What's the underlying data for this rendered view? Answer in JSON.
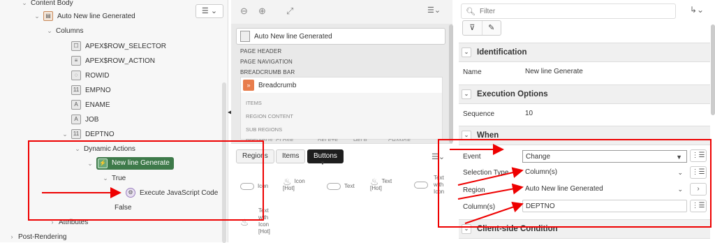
{
  "tree": {
    "items": [
      {
        "label": "Content Body",
        "chevron": "⌄"
      },
      {
        "label": "Auto New line Generated",
        "chevron": "⌄"
      },
      {
        "label": "Columns",
        "chevron": "⌄"
      },
      {
        "label": "APEX$ROW_SELECTOR"
      },
      {
        "label": "APEX$ROW_ACTION"
      },
      {
        "label": "ROWID"
      },
      {
        "label": "EMPNO"
      },
      {
        "label": "ENAME"
      },
      {
        "label": "JOB"
      },
      {
        "label": "DEPTNO",
        "chevron": "⌄"
      },
      {
        "label": "Dynamic Actions",
        "chevron": "⌄"
      },
      {
        "label": "New line Generate",
        "chevron": "⌄"
      },
      {
        "label": "True",
        "chevron": "⌄"
      },
      {
        "label": "Execute JavaScript Code"
      },
      {
        "label": "False"
      },
      {
        "label": "Attributes",
        "chevron": "›"
      },
      {
        "label": "Post-Rendering",
        "chevron": "›"
      }
    ]
  },
  "layout_panel": {
    "page_item": "Auto New line Generated",
    "labels": [
      "PAGE HEADER",
      "PAGE NAVIGATION",
      "BREADCRUMB BAR"
    ],
    "breadcrumb": "Breadcrumb",
    "sub_labels": [
      "ITEMS",
      "REGION CONTENT",
      "SUB REGIONS"
    ],
    "button_positions": [
      "PREVIOUS",
      "CLOSE",
      "DELETE",
      "HELP",
      "CHANGE"
    ]
  },
  "gallery": {
    "tabs": [
      "Regions",
      "Items",
      "Buttons"
    ],
    "active_tab": "Buttons",
    "items": [
      {
        "label": "Icon"
      },
      {
        "label": "Icon [Hot]"
      },
      {
        "label": "Text"
      },
      {
        "label": "Text [Hot]"
      },
      {
        "label": "Text with Icon"
      },
      {
        "label": "Text with Icon [Hot]"
      }
    ]
  },
  "property_editor": {
    "filter_placeholder": "Filter",
    "sections": [
      {
        "title": "Identification"
      },
      {
        "title": "Execution Options"
      },
      {
        "title": "When"
      },
      {
        "title": "Client-side Condition"
      }
    ],
    "name_label": "Name",
    "name_value": "New line Generate",
    "sequence_label": "Sequence",
    "sequence_value": "10",
    "event_label": "Event",
    "event_value": "Change",
    "selection_type_label": "Selection Type",
    "selection_type_value": "Column(s)",
    "region_label": "Region",
    "region_value": "Auto New line Generated",
    "columns_label": "Column(s)",
    "columns_value": "DEPTNO"
  },
  "colors": {
    "annotation": "#e00000",
    "selected": "#3e7a4a"
  },
  "icons": [
    "zoom-out-icon",
    "zoom-in-icon",
    "expand-icon",
    "menu-icon",
    "filter-icon",
    "edit-icon",
    "goto-icon",
    "list-icon"
  ]
}
